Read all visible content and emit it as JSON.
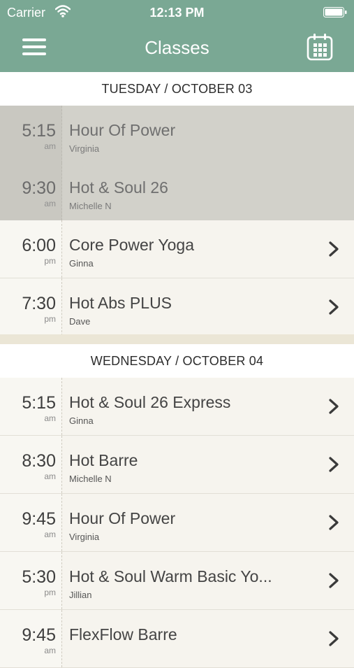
{
  "status_bar": {
    "carrier": "Carrier",
    "time": "12:13 PM"
  },
  "navbar": {
    "title": "Classes"
  },
  "days": [
    {
      "header": "TUESDAY / OCTOBER 03",
      "classes": [
        {
          "time": "5:15",
          "ampm": "am",
          "name": "Hour Of Power",
          "instructor": "Virginia",
          "past": true
        },
        {
          "time": "9:30",
          "ampm": "am",
          "name": "Hot & Soul 26",
          "instructor": "Michelle N",
          "past": true
        },
        {
          "time": "6:00",
          "ampm": "pm",
          "name": "Core Power Yoga",
          "instructor": "Ginna",
          "past": false
        },
        {
          "time": "7:30",
          "ampm": "pm",
          "name": "Hot Abs PLUS",
          "instructor": "Dave",
          "past": false
        }
      ]
    },
    {
      "header": "WEDNESDAY / OCTOBER 04",
      "classes": [
        {
          "time": "5:15",
          "ampm": "am",
          "name": "Hot & Soul 26 Express",
          "instructor": "Ginna",
          "past": false
        },
        {
          "time": "8:30",
          "ampm": "am",
          "name": "Hot Barre",
          "instructor": "Michelle N",
          "past": false
        },
        {
          "time": "9:45",
          "ampm": "am",
          "name": "Hour Of Power",
          "instructor": "Virginia",
          "past": false
        },
        {
          "time": "5:30",
          "ampm": "pm",
          "name": "Hot & Soul Warm Basic Yo...",
          "instructor": "Jillian",
          "past": false
        },
        {
          "time": "9:45",
          "ampm": "am",
          "name": "FlexFlow Barre",
          "instructor": "",
          "past": false
        }
      ]
    }
  ],
  "icons": {
    "menu": "hamburger-menu-icon",
    "calendar": "calendar-icon",
    "chevron": "chevron-right-icon",
    "wifi": "wifi-icon",
    "battery": "battery-icon"
  },
  "colors": {
    "header": "#7aa894",
    "past_row": "#d2d1ca",
    "row": "#f6f4ee"
  }
}
